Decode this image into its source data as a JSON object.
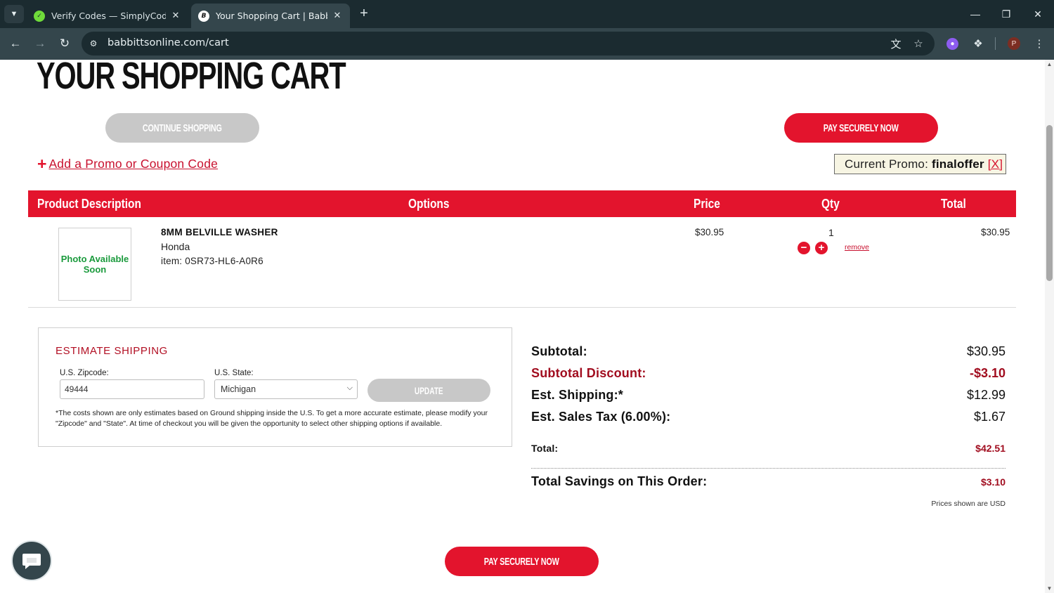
{
  "browser": {
    "tabs": [
      {
        "title": "Verify Codes — SimplyCodes",
        "favicon": "simplycodes-icon",
        "active": false
      },
      {
        "title": "Your Shopping Cart | Babbitts O",
        "favicon": "babbitts-icon",
        "active": true
      }
    ],
    "url": "babbittsonline.com/cart"
  },
  "page": {
    "title": "YOUR SHOPPING CART",
    "continue_label": "CONTINUE SHOPPING",
    "pay_label": "PAY SECURELY NOW",
    "promo_link": "Add a Promo or Coupon Code",
    "current_promo_label": "Current Promo:",
    "current_promo_code": "finaloffer",
    "current_promo_remove": "[X]"
  },
  "cart": {
    "columns": [
      "Product Description",
      "Options",
      "Price",
      "Qty",
      "Total"
    ],
    "items": [
      {
        "image_text": "Photo Available Soon",
        "name": "8MM BELVILLE WASHER",
        "brand": "Honda",
        "item": "item: 0SR73-HL6-A0R6",
        "price": "$30.95",
        "qty": "1",
        "remove": "remove",
        "total": "$30.95"
      }
    ]
  },
  "shipping": {
    "title": "ESTIMATE SHIPPING",
    "zip_label": "U.S. Zipcode:",
    "zip_value": "49444",
    "state_label": "U.S. State:",
    "state_value": "Michigan",
    "update_label": "UPDATE",
    "note": "*The costs shown are only estimates based on Ground shipping inside the U.S. To get a more accurate estimate, please modify your \"Zipcode\" and \"State\". At time of checkout you will be given the opportunity to select other shipping options if available."
  },
  "summary": {
    "subtotal_label": "Subtotal:",
    "subtotal": "$30.95",
    "discount_label": "Subtotal Discount:",
    "discount": "-$3.10",
    "shipping_label": "Est. Shipping:*",
    "shipping": "$12.99",
    "tax_label": "Est. Sales Tax (6.00%):",
    "tax": "$1.67",
    "total_label": "Total:",
    "total": "$42.51",
    "savings_label": "Total Savings on This Order:",
    "savings": "$3.10",
    "currency_note": "Prices shown are USD"
  },
  "colors": {
    "brand_red": "#e3142d",
    "dark_red": "#a10d1f",
    "chrome_dark": "#1b2b30",
    "chrome_mid": "#34464c"
  }
}
